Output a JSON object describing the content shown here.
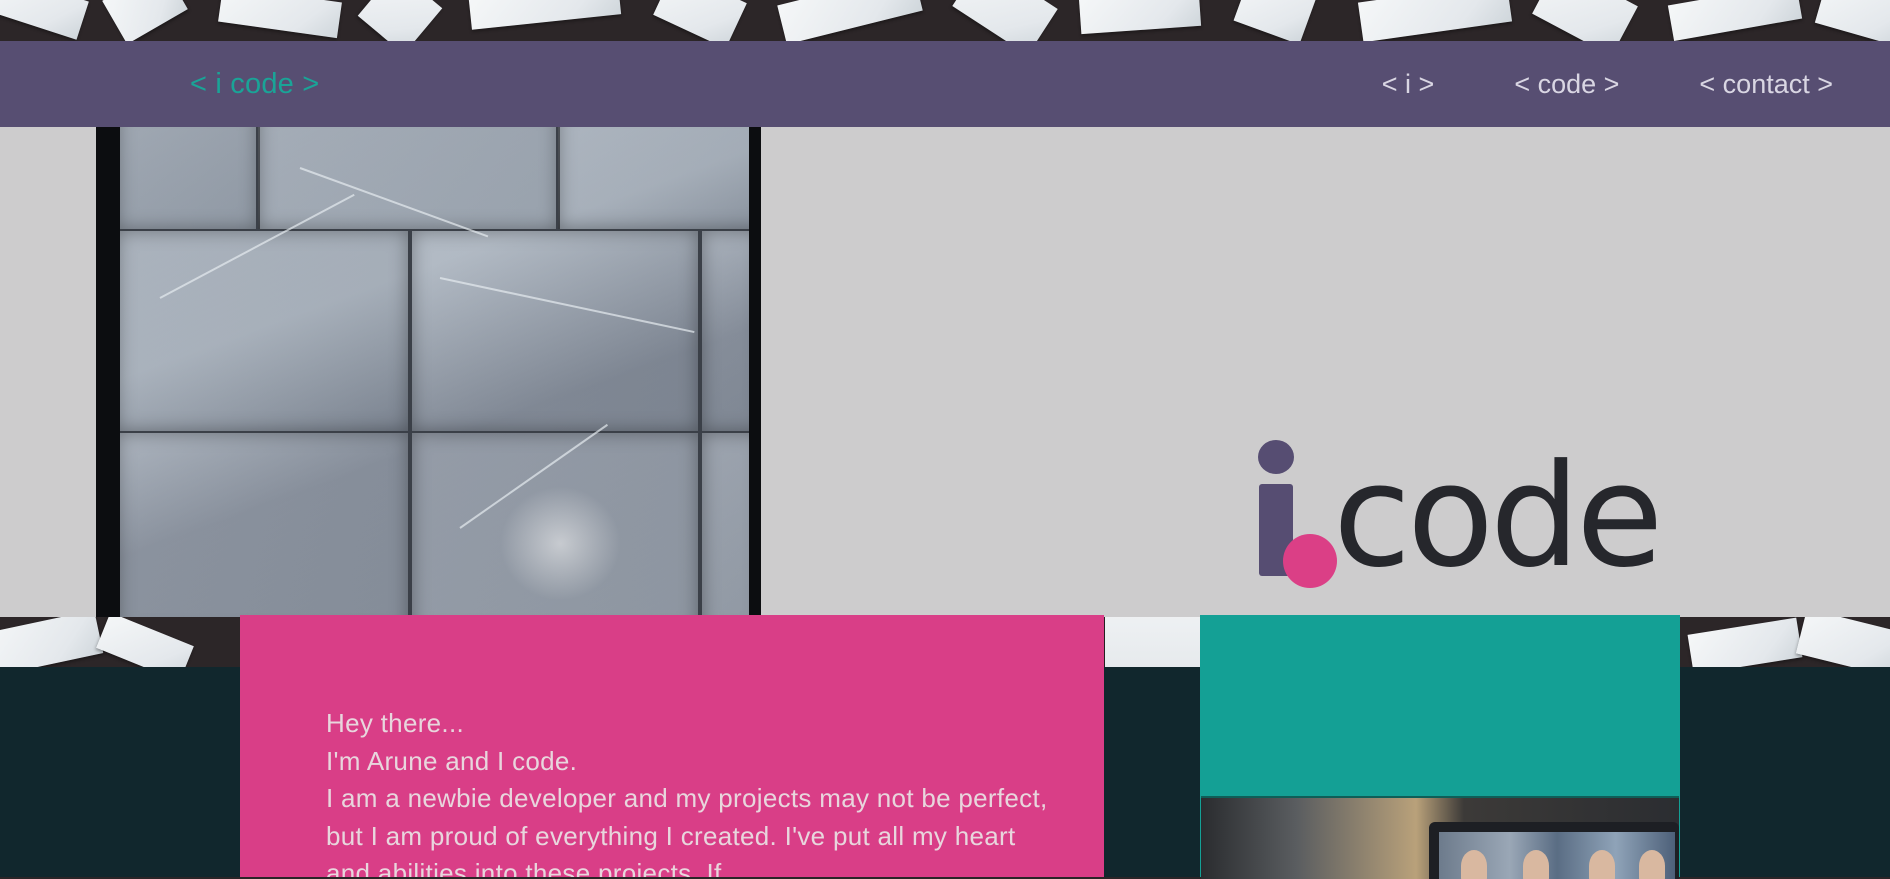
{
  "header": {
    "logo_text": "< i code >",
    "nav": [
      {
        "label": "< i >"
      },
      {
        "label": "< code >"
      },
      {
        "label": "< contact >"
      }
    ]
  },
  "hero": {
    "brand_word": "code",
    "brand_letter": "i"
  },
  "intro": {
    "text": "Hey there...\nI'm Arune and I code.\nI am a newbie developer and my projects may not be perfect, but I am proud of everything I created. I've put all my heart and abilities into these projects. If"
  },
  "colors": {
    "header_bg": "#574e72",
    "logo_accent": "#1aa497",
    "hero_bg": "#cdcccd",
    "brand_purple": "#564d72",
    "brand_pink": "#db3f86",
    "card_pink": "#d93e87",
    "card_teal": "#14a095",
    "lower_dark": "#11272d"
  }
}
